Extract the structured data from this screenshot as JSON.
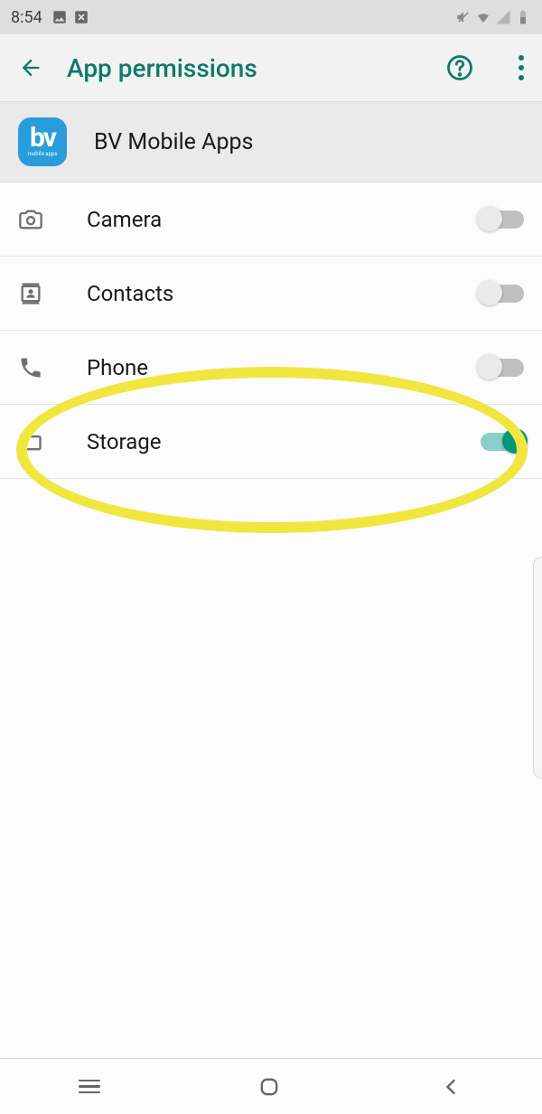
{
  "status": {
    "time": "8:54"
  },
  "header": {
    "title": "App permissions"
  },
  "app": {
    "name": "BV Mobile Apps",
    "logo_text": "bv",
    "logo_sub": "mobile apps"
  },
  "permissions": [
    {
      "key": "camera",
      "label": "Camera",
      "enabled": false,
      "icon": "camera-icon"
    },
    {
      "key": "contacts",
      "label": "Contacts",
      "enabled": false,
      "icon": "contacts-icon"
    },
    {
      "key": "phone",
      "label": "Phone",
      "enabled": false,
      "icon": "phone-icon"
    },
    {
      "key": "storage",
      "label": "Storage",
      "enabled": true,
      "icon": "folder-icon"
    }
  ],
  "highlight": {
    "target": "storage"
  }
}
